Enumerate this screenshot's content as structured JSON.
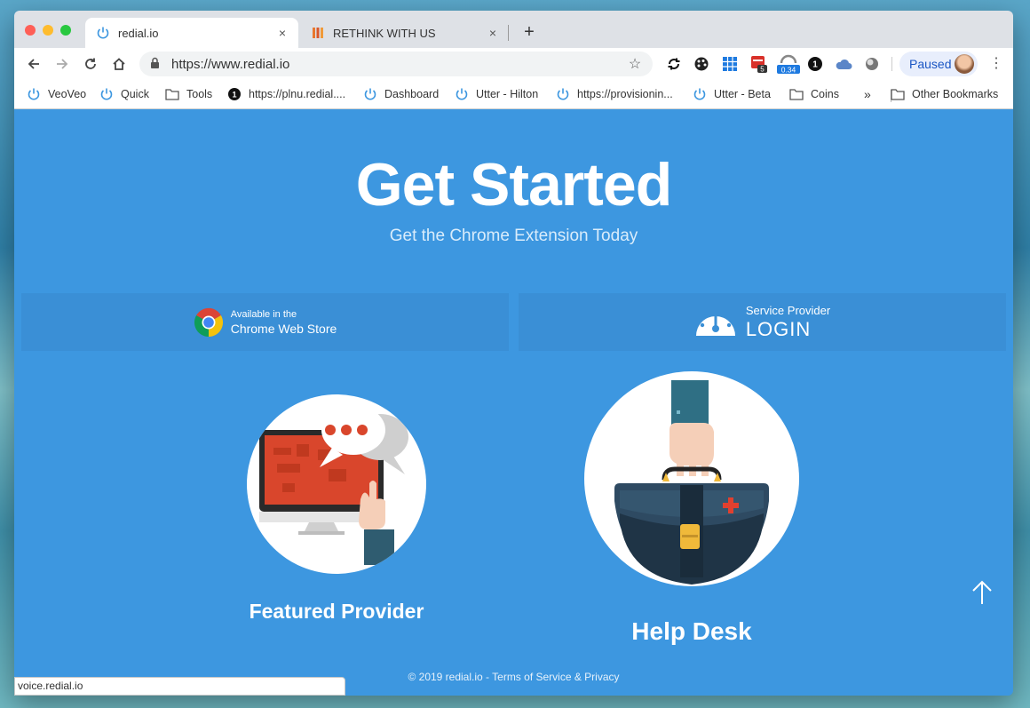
{
  "tabs": [
    {
      "title": "redial.io",
      "close": "×"
    },
    {
      "title": "RETHINK WITH US",
      "close": "×"
    }
  ],
  "new_tab": "+",
  "address": {
    "url": "https://www.redial.io"
  },
  "profile": {
    "label": "Paused"
  },
  "extensions": {
    "badge_5": "5",
    "badge_034": "0.34",
    "badge_1": "1"
  },
  "bookmarks": [
    {
      "label": "VeoVeo"
    },
    {
      "label": "Quick"
    },
    {
      "label": "Tools"
    },
    {
      "label": "https://plnu.redial...."
    },
    {
      "label": "Dashboard"
    },
    {
      "label": "Utter - Hilton"
    },
    {
      "label": "https://provisionin..."
    },
    {
      "label": "Utter - Beta"
    },
    {
      "label": "Coins"
    }
  ],
  "bookmarks_overflow": "»",
  "other_bookmarks": "Other Bookmarks",
  "page": {
    "title": "Get Started",
    "subtitle": "Get the Chrome Extension Today",
    "store_button": {
      "small": "Available in the",
      "big": "Chrome Web Store"
    },
    "login_button": {
      "small": "Service Provider",
      "big": "LOGIN"
    },
    "featured_label": "Featured Provider",
    "helpdesk_label": "Help Desk",
    "footer": "© 2019 redial.io - Terms of Service & Privacy"
  },
  "status_url": "voice.redial.io"
}
